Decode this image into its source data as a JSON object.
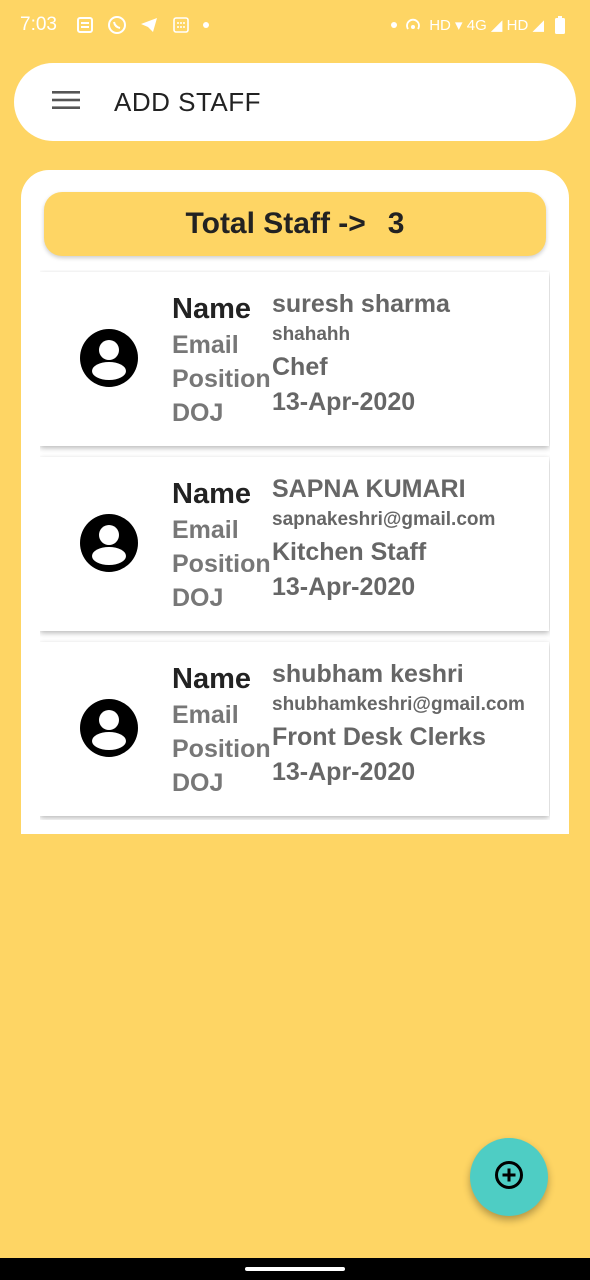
{
  "status_bar": {
    "time": "7:03",
    "indicators": "HD ▾ 4G ◢ HD ◢",
    "icons": [
      "news-icon",
      "whatsapp-icon",
      "telegram-icon",
      "calculator-icon",
      "hotspot-icon",
      "signal-icon",
      "battery-icon"
    ]
  },
  "app_bar": {
    "title": "ADD STAFF",
    "menu_icon": "hamburger-menu-icon"
  },
  "summary": {
    "label": "Total Staff ->",
    "count": "3"
  },
  "staff_labels": {
    "name": "Name",
    "email": "Email",
    "position": "Position",
    "doj": "DOJ"
  },
  "staff": [
    {
      "name": "suresh sharma",
      "email": "shahahh",
      "position": "Chef",
      "doj": "13-Apr-2020"
    },
    {
      "name": "SAPNA KUMARI",
      "email": "sapnakeshri@gmail.com",
      "position": "Kitchen Staff",
      "doj": "13-Apr-2020"
    },
    {
      "name": "shubham keshri",
      "email": "shubhamkeshri@gmail.com",
      "position": "Front Desk Clerks",
      "doj": "13-Apr-2020"
    }
  ],
  "fab": {
    "icon": "add-circle-icon"
  },
  "colors": {
    "background": "#FED564",
    "fab": "#4ECDC4",
    "card": "#FFFFFF"
  }
}
